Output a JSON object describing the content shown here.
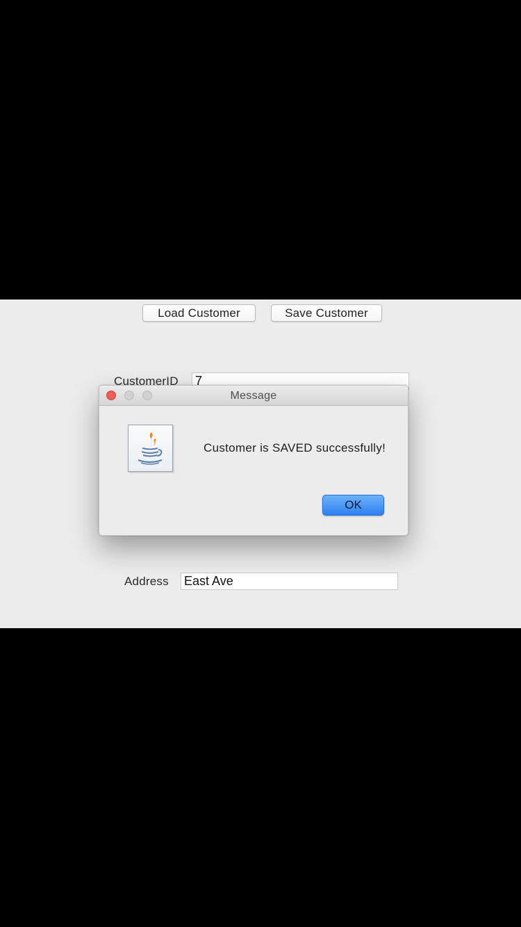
{
  "toolbar": {
    "load_label": "Load Customer",
    "save_label": "Save Customer"
  },
  "form": {
    "customerid_label": "CustomerID",
    "customerid_value": "7",
    "address_label": "Address",
    "address_value": "East Ave"
  },
  "dialog": {
    "title": "Message",
    "message": "Customer is SAVED successfully!",
    "ok_label": "OK",
    "icon": "java-coffee-cup-icon"
  },
  "colors": {
    "screen_background": "#000000",
    "window_background": "#ececec",
    "ok_button_accent": "#3b87f5",
    "close_button_red": "#ec5f57"
  }
}
